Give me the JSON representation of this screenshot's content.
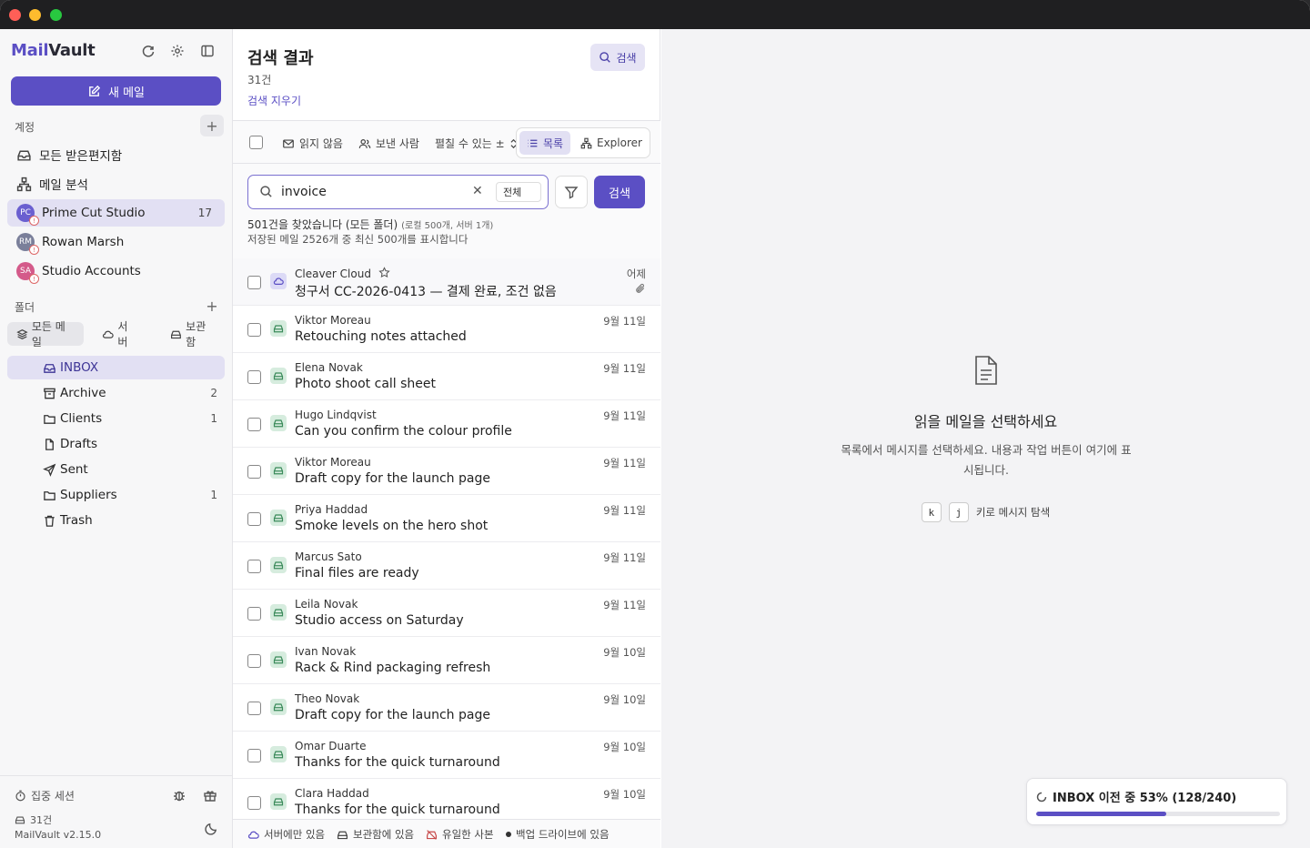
{
  "app": {
    "name_mail": "Mail",
    "name_vault": "Vault",
    "version": "MailVault v2.15.0"
  },
  "sidebar": {
    "new_mail": "새 메일",
    "accounts_label": "계정",
    "all_inbox": "모든 받은편지함",
    "mail_analysis": "메일 분석",
    "accounts": [
      {
        "initials": "PC",
        "name": "Prime Cut Studio",
        "count": "17",
        "color": "#6a5fd0",
        "active": true
      },
      {
        "initials": "RM",
        "name": "Rowan Marsh",
        "count": "",
        "color": "#7a7f9a",
        "active": false
      },
      {
        "initials": "SA",
        "name": "Studio Accounts",
        "count": "",
        "color": "#d45a8a",
        "active": false
      }
    ],
    "folders_label": "폴더",
    "segments": [
      {
        "label": "모든 메일",
        "icon": "layers-icon",
        "active": true
      },
      {
        "label": "서버",
        "icon": "cloud-icon",
        "active": false
      },
      {
        "label": "보관함",
        "icon": "drive-icon",
        "active": false
      }
    ],
    "folders": [
      {
        "label": "INBOX",
        "count": "",
        "icon": "inbox-icon",
        "active": true
      },
      {
        "label": "Archive",
        "count": "2",
        "icon": "archive-icon",
        "active": false
      },
      {
        "label": "Clients",
        "count": "1",
        "icon": "folder-icon",
        "active": false
      },
      {
        "label": "Drafts",
        "count": "",
        "icon": "file-icon",
        "active": false
      },
      {
        "label": "Sent",
        "count": "",
        "icon": "send-icon",
        "active": false
      },
      {
        "label": "Suppliers",
        "count": "1",
        "icon": "folder-icon",
        "active": false
      },
      {
        "label": "Trash",
        "count": "",
        "icon": "trash-icon",
        "active": false
      }
    ],
    "focus_session": "집중 세션",
    "footer_count": "31건"
  },
  "list": {
    "title": "검색 결과",
    "count": "31건",
    "clear_search": "검색 지우기",
    "search_button_top": "검색",
    "toolbar": {
      "unread": "읽지 않음",
      "sender": "보낸 사람",
      "editable": "펼칠 수 있는 ±",
      "view_list": "목록",
      "view_explorer": "Explorer"
    },
    "search": {
      "value": "invoice",
      "scope": "전체",
      "go": "검색",
      "result_main": "501건을 찾았습니다 (모든 폴더)",
      "result_sub": "(로컬 500개, 서버 1개)",
      "result_line2": "저장된 메일 2526개 중 최신 500개를 표시합니다"
    },
    "rows": [
      {
        "sender": "Cleaver Cloud",
        "subject": "청구서 CC-2026-0413 — 결제 완료, 조건 없음",
        "date": "어제",
        "source": "cloud",
        "starrable": true,
        "attachment": true
      },
      {
        "sender": "Viktor Moreau",
        "subject": "Retouching notes attached",
        "date": "9월 11일",
        "source": "drive"
      },
      {
        "sender": "Elena Novak",
        "subject": "Photo shoot call sheet",
        "date": "9월 11일",
        "source": "drive"
      },
      {
        "sender": "Hugo Lindqvist",
        "subject": "Can you confirm the colour profile",
        "date": "9월 11일",
        "source": "drive"
      },
      {
        "sender": "Viktor Moreau",
        "subject": "Draft copy for the launch page",
        "date": "9월 11일",
        "source": "drive"
      },
      {
        "sender": "Priya Haddad",
        "subject": "Smoke levels on the hero shot",
        "date": "9월 11일",
        "source": "drive"
      },
      {
        "sender": "Marcus Sato",
        "subject": "Final files are ready",
        "date": "9월 11일",
        "source": "drive"
      },
      {
        "sender": "Leila Novak",
        "subject": "Studio access on Saturday",
        "date": "9월 11일",
        "source": "drive"
      },
      {
        "sender": "Ivan Novak",
        "subject": "Rack & Rind packaging refresh",
        "date": "9월 10일",
        "source": "drive"
      },
      {
        "sender": "Theo Novak",
        "subject": "Draft copy for the launch page",
        "date": "9월 10일",
        "source": "drive"
      },
      {
        "sender": "Omar Duarte",
        "subject": "Thanks for the quick turnaround",
        "date": "9월 10일",
        "source": "drive"
      },
      {
        "sender": "Clara Haddad",
        "subject": "Thanks for the quick turnaround",
        "date": "9월 10일",
        "source": "drive"
      }
    ],
    "legend": {
      "server_only": "서버에만 있음",
      "archive_only": "보관함에 있음",
      "unique_copy": "유일한 사본",
      "backup_drive": "백업 드라이브에 있음"
    }
  },
  "reader": {
    "empty_title": "읽을 메일을 선택하세요",
    "empty_desc": "목록에서 메시지를 선택하세요. 내용과 작업 버튼이 여기에 표시됩니다.",
    "key_k": "k",
    "key_j": "j",
    "key_hint": "키로 메시지 탐색",
    "progress_text": "INBOX 이전 중 53% (128/240)",
    "progress_fraction": 0.533
  },
  "colors": {
    "accent": "#5b4fc4",
    "accent_soft": "#e2e0f3"
  }
}
